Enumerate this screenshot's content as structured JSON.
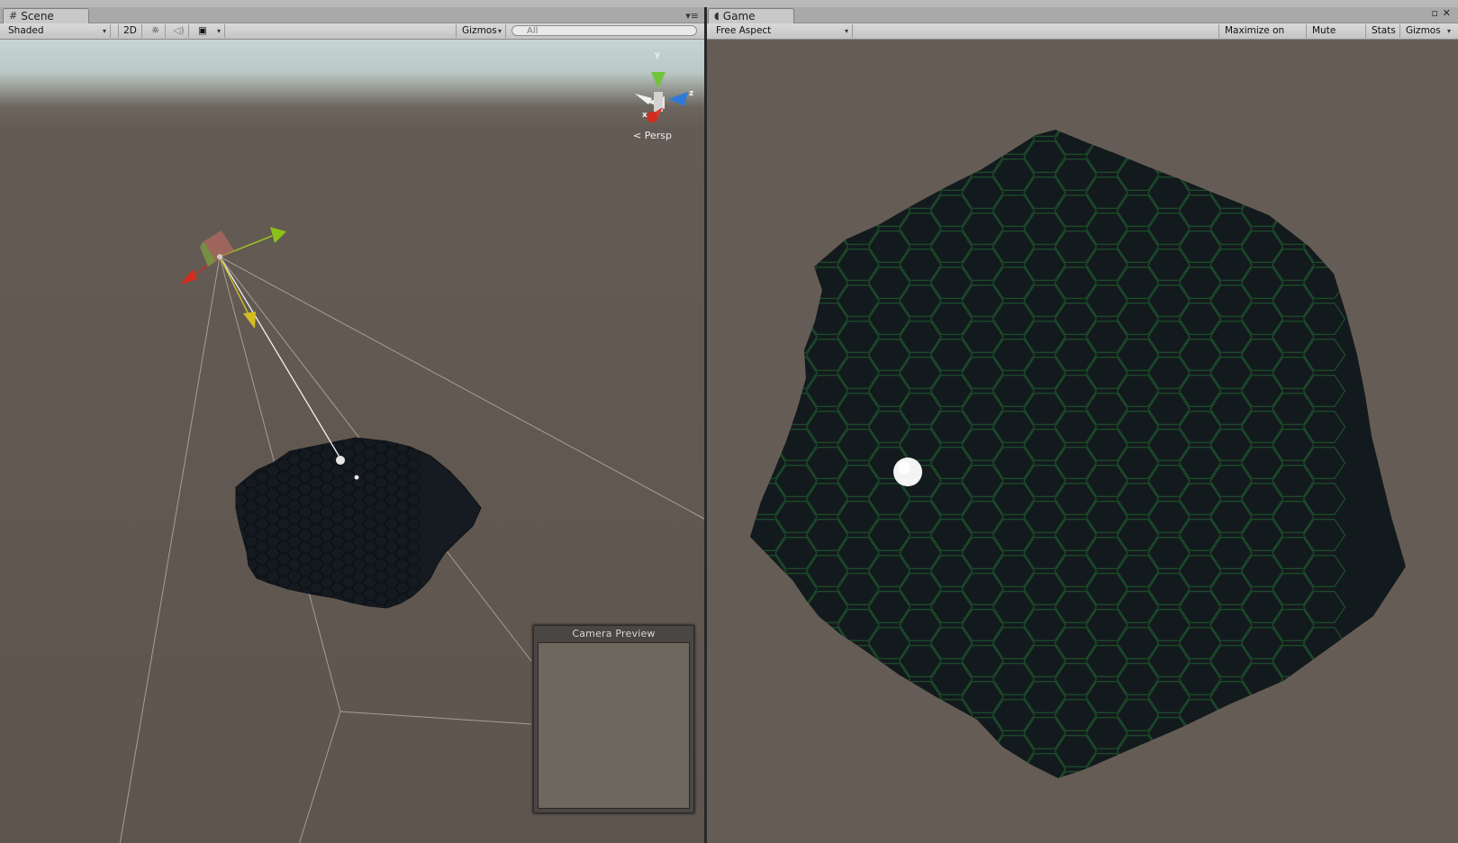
{
  "scene": {
    "tab_label": "Scene",
    "tab_icon": "grid-icon",
    "shading_mode": "Shaded",
    "mode_2d_label": "2D",
    "gizmos_label": "Gizmos",
    "search_value": "All",
    "persp_label": "Persp",
    "axis_labels": {
      "x": "x",
      "y": "y",
      "z": "z"
    },
    "camera_preview_title": "Camera Preview"
  },
  "game": {
    "tab_label": "Game",
    "tab_icon": "pacman-icon",
    "aspect": "Free Aspect",
    "maximize_label": "Maximize on Play",
    "mute_label": "Mute audio",
    "stats_label": "Stats",
    "gizmos_label": "Gizmos"
  },
  "colors": {
    "hex_fill": "#131a1d",
    "hex_edge": "#1f5a2e",
    "ground": "#655d55",
    "sky": "#c6d5d4"
  }
}
